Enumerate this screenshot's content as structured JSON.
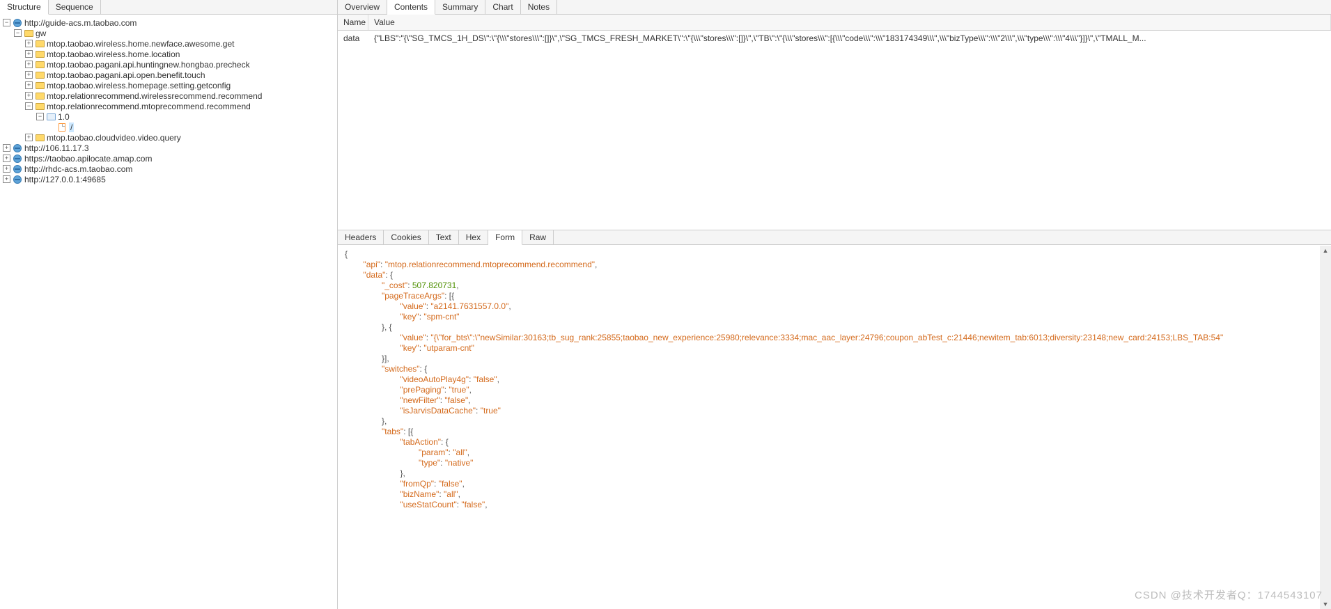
{
  "leftTabs": {
    "structure": "Structure",
    "sequence": "Sequence"
  },
  "tree": {
    "root0": {
      "label": "http://guide-acs.m.taobao.com"
    },
    "gw": {
      "label": "gw"
    },
    "n0": "mtop.taobao.wireless.home.newface.awesome.get",
    "n1": "mtop.taobao.wireless.home.location",
    "n2": "mtop.taobao.pagani.api.huntingnew.hongbao.precheck",
    "n3": "mtop.taobao.pagani.api.open.benefit.touch",
    "n4": "mtop.taobao.wireless.homepage.setting.getconfig",
    "n5": "mtop.relationrecommend.wirelessrecommend.recommend",
    "n6": "mtop.relationrecommend.mtoprecommend.recommend",
    "v10": "1.0",
    "slash": "/",
    "n7": "mtop.taobao.cloudvideo.video.query",
    "root1": "http://106.11.17.3",
    "root2": "https://taobao.apilocate.amap.com",
    "root3": "http://rhdc-acs.m.taobao.com",
    "root4": "http://127.0.0.1:49685"
  },
  "rightUpperTabs": {
    "overview": "Overview",
    "contents": "Contents",
    "summary": "Summary",
    "chart": "Chart",
    "notes": "Notes"
  },
  "contentsTable": {
    "headers": {
      "name": "Name",
      "value": "Value"
    },
    "row0": {
      "name": "data",
      "value": "{\"LBS\":\"{\\\"SG_TMCS_1H_DS\\\":\\\"{\\\\\\\"stores\\\\\\\":[]}\\\",\\\"SG_TMCS_FRESH_MARKET\\\":\\\"{\\\\\\\"stores\\\\\\\":[]}\\\",\\\"TB\\\":\\\"{\\\\\\\"stores\\\\\\\":[{\\\\\\\"code\\\\\\\":\\\\\\\"183174349\\\\\\\",\\\\\\\"bizType\\\\\\\":\\\\\\\"2\\\\\\\",\\\\\\\"type\\\\\\\":\\\\\\\"4\\\\\\\"}]}\\\",\\\"TMALL_M..."
    }
  },
  "rightLowerTabs": {
    "headers": "Headers",
    "cookies": "Cookies",
    "text": "Text",
    "hex": "Hex",
    "form": "Form",
    "raw": "Raw"
  },
  "json": {
    "api": "mtop.relationrecommend.mtoprecommend.recommend",
    "cost": "507.820731",
    "pt0_value": "a2141.7631557.0.0",
    "pt0_key": "spm-cnt",
    "pt1_value": "{\\\"for_bts\\\":\\\"newSimilar:30163;tb_sug_rank:25855;taobao_new_experience:25980;relevance:3334;mac_aac_layer:24796;coupon_abTest_c:21446;newitem_tab:6013;diversity:23148;new_card:24153;LBS_TAB:54",
    "pt1_key": "utparam-cnt",
    "sw_videoAutoPlay4g": "false",
    "sw_prePaging": "true",
    "sw_newFilter": "false",
    "sw_isJarvisDataCache": "true",
    "tab_param": "all",
    "tab_type": "native",
    "tab_fromQp": "false",
    "tab_bizName": "all",
    "tab_useStatCount": "false"
  },
  "watermark": "CSDN @技术开发者Q：1744543107"
}
